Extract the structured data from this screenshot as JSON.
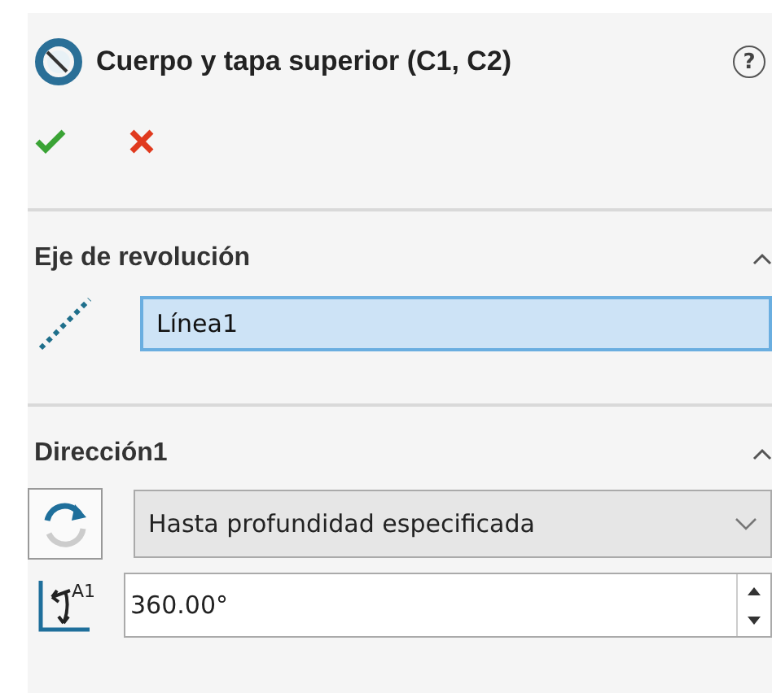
{
  "header": {
    "title": "Cuerpo y tapa superior (C1, C2)",
    "help": "?"
  },
  "sections": [
    {
      "kind": "axis",
      "title": "Eje de revolución",
      "expanded": true,
      "value": "Línea1",
      "focused": true
    },
    {
      "kind": "direction",
      "title": "Dirección1",
      "expanded": true,
      "end_condition": "Hasta profundidad especificada",
      "angle_label": "A1",
      "angle": "360.00°"
    }
  ]
}
